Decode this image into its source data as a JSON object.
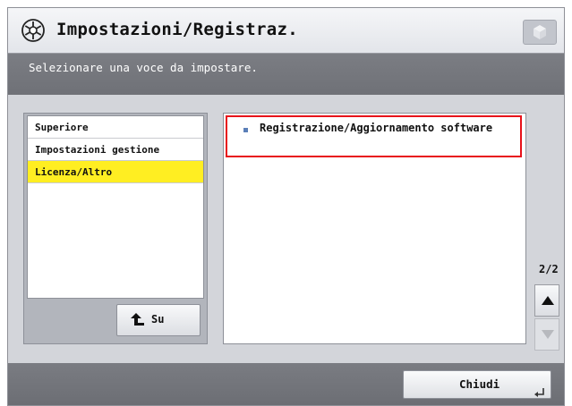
{
  "header": {
    "title": "Impostazioni/Registraz.",
    "settings_icon": "settings-gear-star-icon",
    "right_icon": "cube-icon"
  },
  "instruction": {
    "text": "Selezionare una voce da impostare."
  },
  "left_menu": {
    "items": [
      {
        "label": "Superiore",
        "selected": false
      },
      {
        "label": "Impostazioni gestione",
        "selected": false
      },
      {
        "label": "Licenza/Altro",
        "selected": true
      }
    ],
    "up_button_label": "Su",
    "up_button_icon": "up-arrow-icon"
  },
  "content": {
    "items": [
      {
        "label": "Registrazione/Aggiornamento software",
        "highlighted": true
      }
    ]
  },
  "pagination": {
    "indicator": "2/2",
    "up_icon": "scroll-up-triangle-icon",
    "down_icon": "scroll-down-triangle-icon"
  },
  "footer": {
    "close_label": "Chiudi",
    "close_icon": "enter-return-icon"
  },
  "colors": {
    "selected_item": "#ffee22",
    "highlight_border": "#e8121a",
    "instruction_bar": "#75777d"
  }
}
